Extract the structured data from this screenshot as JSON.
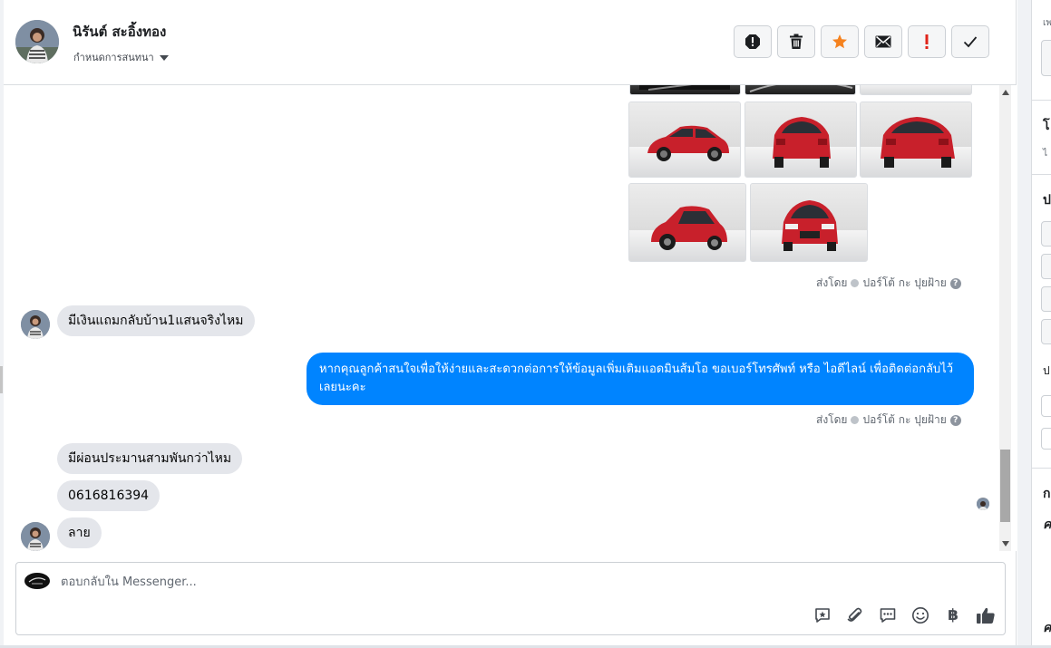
{
  "contact": {
    "name": "นิรันต์ สะอิ้งทอง",
    "conversation_settings": "กำหนดการสนทนา"
  },
  "header_actions": [
    {
      "name": "spam-icon",
      "color": "#1c1e21"
    },
    {
      "name": "trash-icon",
      "color": "#1c1e21"
    },
    {
      "name": "star-icon",
      "color": "#f5821f"
    },
    {
      "name": "envelope-icon",
      "color": "#1c1e21"
    },
    {
      "name": "exclamation-icon",
      "color": "#e0241a"
    },
    {
      "name": "checkmark-icon",
      "color": "#1c1e21"
    }
  ],
  "messages": {
    "sent_by_1": "ส่งโดย",
    "sender_name_1": "ปอร์โต้ กะ ปุยฝ้าย",
    "incoming_1": "มีเงินแถมกลับบ้าน1แสนจริงไหม",
    "outgoing_1": "หากคุณลูกค้าสนใจเพื่อให้ง่ายและสะดวกต่อการให้ข้อมูลเพิ่มเติมแอดมินส้มโอ ขอเบอร์โทรศัพท์ หรือ ไอดีไลน์ เพื่อติดต่อกลับไว้เลยนะคะ",
    "sent_by_2": "ส่งโดย",
    "sender_name_2": "ปอร์โต้ กะ ปุยฝ้าย",
    "incoming_2": "มีผ่อนประมานสามพันกว่าไหม",
    "incoming_3": "0616816394",
    "incoming_4": "ลาย"
  },
  "composer": {
    "placeholder": "ตอบกลับใน Messenger...",
    "tools": [
      "saved-reply-icon",
      "attachment-icon",
      "chat-bubble-icon",
      "emoji-icon",
      "baht-icon",
      "thumbs-up-icon"
    ],
    "baht_symbol": "฿"
  },
  "colors": {
    "outgoing_bubble": "#0084ff",
    "incoming_bubble": "#e4e6eb",
    "car_red": "#c8202b"
  }
}
